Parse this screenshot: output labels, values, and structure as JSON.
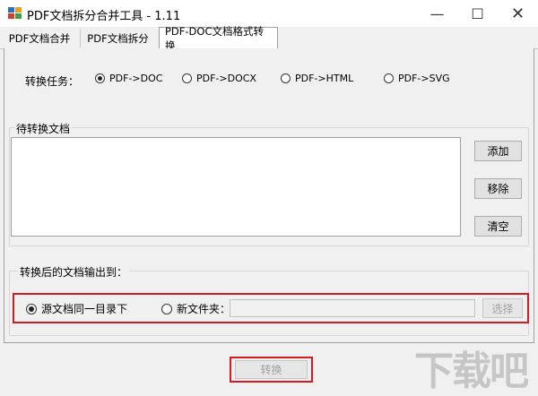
{
  "window": {
    "title": "PDF文档拆分合并工具 - 1.11",
    "minimize": "—",
    "maximize": "☐",
    "close": "✕"
  },
  "tabs": [
    {
      "label": "PDF文档合并",
      "selected": false
    },
    {
      "label": "PDF文档拆分",
      "selected": false
    },
    {
      "label": "PDF-DOC文档格式转换",
      "selected": true
    }
  ],
  "task": {
    "label": "转换任务：",
    "options": [
      {
        "label": "PDF->DOC",
        "checked": true
      },
      {
        "label": "PDF->DOCX",
        "checked": false
      },
      {
        "label": "PDF->HTML",
        "checked": false
      },
      {
        "label": "PDF->SVG",
        "checked": false
      }
    ]
  },
  "files": {
    "group_label": "待转换文档",
    "buttons": {
      "add": "添加",
      "remove": "移除",
      "clear": "清空"
    }
  },
  "output": {
    "group_label": "转换后的文档输出到：",
    "option_same_dir": "源文档同一目录下",
    "option_new_folder": "新文件夹：",
    "same_dir_checked": true,
    "folder_value": "",
    "select_button": "选择"
  },
  "convert_button": "转换",
  "colors": {
    "highlight": "#d71920"
  },
  "watermark": "下载吧"
}
